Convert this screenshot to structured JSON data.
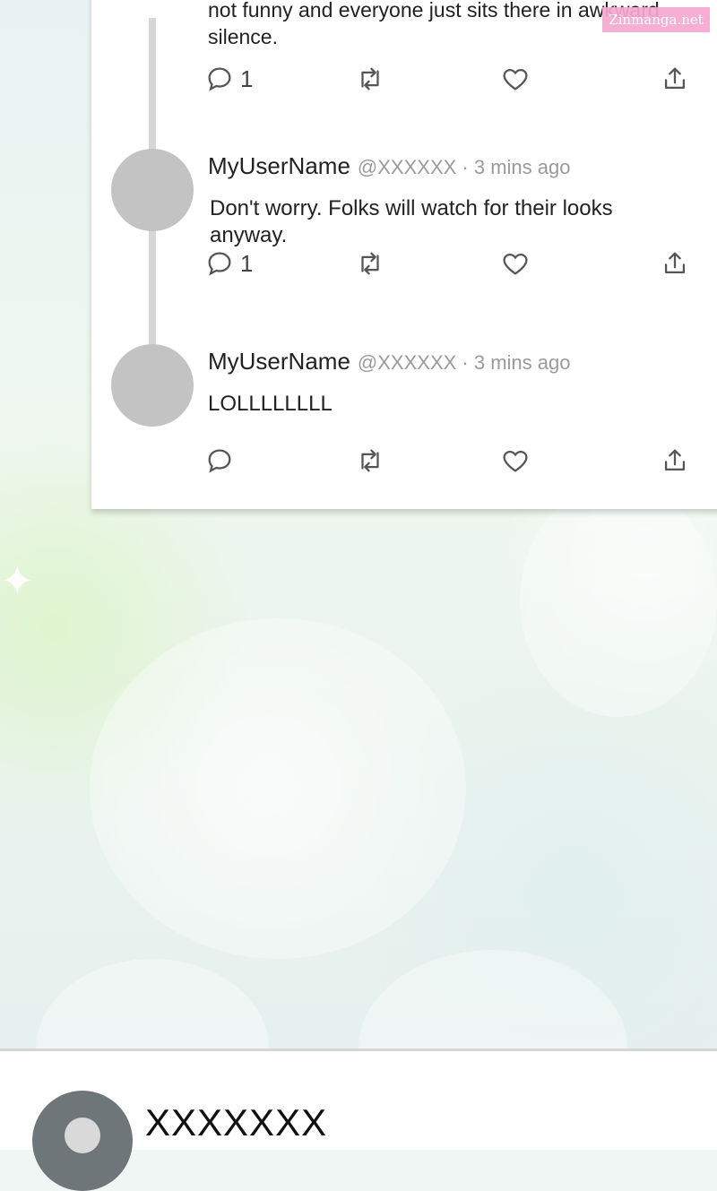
{
  "watermark": "Zinmanga.net",
  "thread": {
    "partial_text_line1": "not funny and everyone just sits there in awkward",
    "partial_text_line2": "silence.",
    "top_reply_count": "1",
    "tweets": [
      {
        "username": "MyUserName",
        "handle_time": "@XXXXXX · 3 mins ago",
        "text": "Don't worry. Folks will watch for their looks anyway.",
        "reply_count": "1"
      },
      {
        "username": "MyUserName",
        "handle_time": "@XXXXXX · 3 mins ago",
        "text": "LOLLLLLLLL",
        "reply_count": ""
      }
    ]
  },
  "bottom_profile": {
    "name": "XXXXXXX"
  },
  "icons": [
    "reply-icon",
    "retweet-icon",
    "like-icon",
    "share-icon",
    "chevron-down-icon"
  ],
  "colors": {
    "avatar_placeholder": "#c3c3c3",
    "icon_stroke": "#555555",
    "handle_text": "#9a9a9a"
  }
}
